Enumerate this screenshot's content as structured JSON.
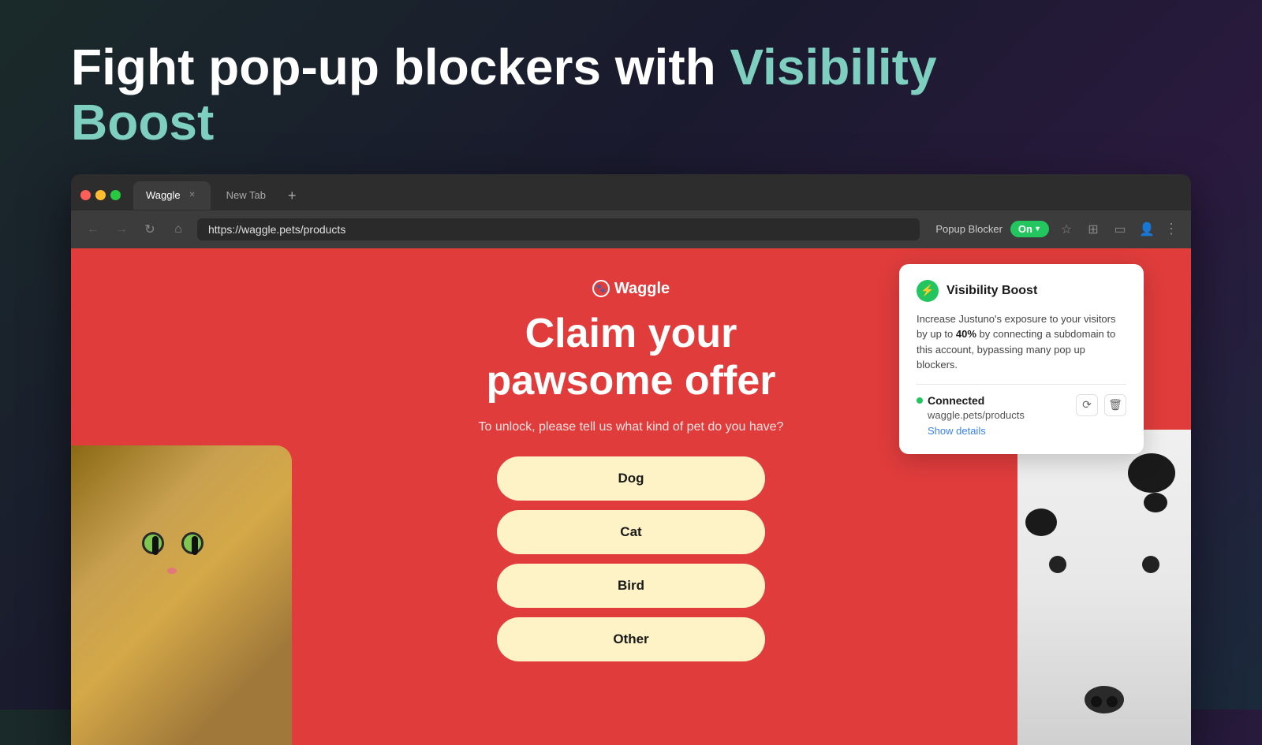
{
  "page": {
    "title": "Fight pop-up blockers with Visibility Boost",
    "title_plain": "Fight pop-up blockers with ",
    "title_highlight": "Visibility Boost"
  },
  "browser": {
    "tabs": [
      {
        "id": "waggle",
        "label": "Waggle",
        "active": true
      },
      {
        "id": "new-tab",
        "label": "New Tab",
        "active": false
      }
    ],
    "url": "https://waggle.pets/products",
    "popup_blocker_label": "Popup Blocker",
    "popup_blocker_state": "On",
    "nav": {
      "back": "←",
      "forward": "→",
      "refresh": "↻",
      "home": "⌂"
    }
  },
  "webpage": {
    "logo": "Waggle",
    "offer_title_line1": "Claim your",
    "offer_title_line2": "pawsome offer",
    "offer_subtitle": "To unlock, please tell us what kind of pet do you have?",
    "buttons": [
      {
        "id": "dog",
        "label": "Dog"
      },
      {
        "id": "cat",
        "label": "Cat"
      },
      {
        "id": "bird",
        "label": "Bird"
      },
      {
        "id": "other",
        "label": "Other"
      }
    ]
  },
  "visibility_boost": {
    "title": "Visibility Boost",
    "description_part1": "Increase Justuno's exposure to your visitors by up to ",
    "highlight": "40%",
    "description_part2": " by connecting a subdomain to this account, bypassing many pop up blockers.",
    "status": "Connected",
    "domain": "waggle.pets/products",
    "show_details_label": "Show details",
    "refresh_icon": "⟳",
    "delete_icon": "🗑"
  }
}
